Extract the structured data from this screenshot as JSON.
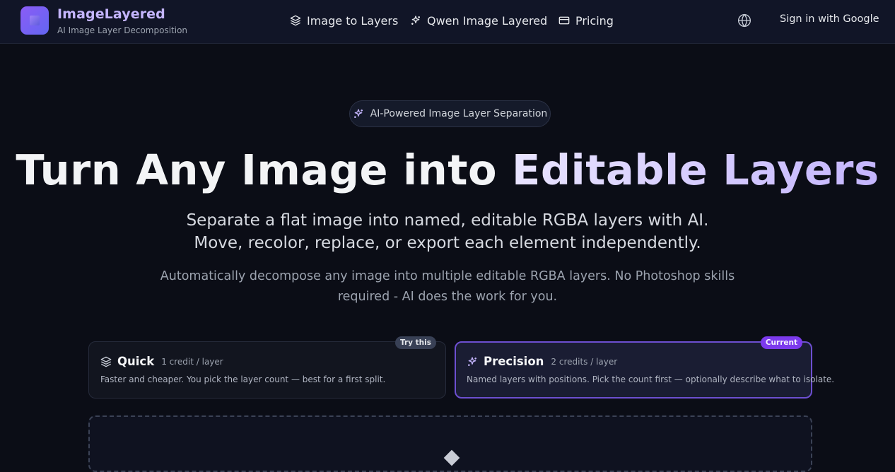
{
  "brand": {
    "name": "ImageLayered",
    "tagline": "AI Image Layer Decomposition",
    "logo_icon": "layers-logo-icon"
  },
  "nav": {
    "items": [
      {
        "label": "Image to Layers",
        "icon": "layers-icon"
      },
      {
        "label": "Qwen Image Layered",
        "icon": "sparkle-icon"
      },
      {
        "label": "Pricing",
        "icon": "credit-card-icon"
      }
    ],
    "language_icon": "globe-icon",
    "signin_label": "Sign in with Google"
  },
  "hero": {
    "pill_label": "AI-Powered Image Layer Separation",
    "pill_icon": "sparkle-icon",
    "title_main": "Turn Any Image into ",
    "title_accent": "Editable Layers",
    "subtitle": "Separate a flat image into named, editable RGBA layers with AI. Move, recolor, replace, or export each element independently.",
    "description": "Automatically decompose any image into multiple editable RGBA layers. No Photoshop skills required - AI does the work for you."
  },
  "modes": [
    {
      "name": "Quick",
      "cost": "1 credit / layer",
      "description": "Faster and cheaper. You pick the layer count — best for a first split.",
      "badge": "Try this",
      "icon": "layers-icon",
      "selected": false
    },
    {
      "name": "Precision",
      "cost": "2 credits / layer",
      "description": "Named layers with positions. Pick the count first — optionally describe what to isolate.",
      "badge": "Current",
      "icon": "sparkle-icon",
      "selected": true
    }
  ],
  "upload": {
    "icon": "upload-arrow-icon"
  },
  "colors": {
    "background": "#0b0d16",
    "header": "#111527",
    "accent": "#7c3aed",
    "accent_light": "#c4b5fd"
  }
}
